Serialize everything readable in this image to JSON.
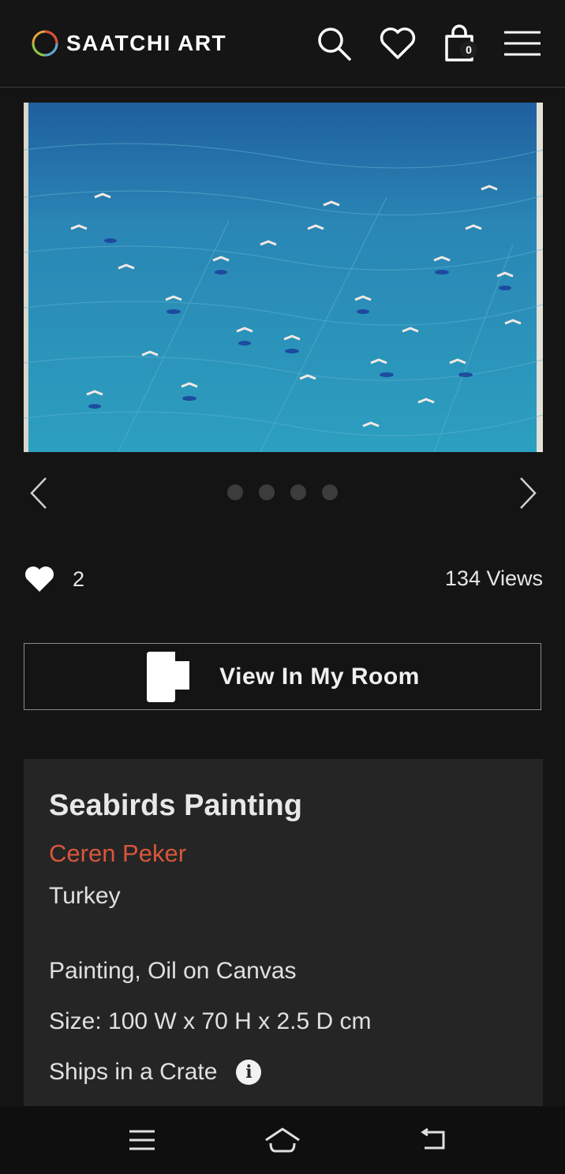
{
  "header": {
    "logo_text": "SAATCHI ART",
    "cart_count": "0",
    "icons": [
      "search-icon",
      "heart-icon",
      "shopping-bag-icon",
      "menu-icon"
    ]
  },
  "artwork": {
    "image_alt": "Seabirds Painting",
    "dots_count": 4,
    "active_dot": 0
  },
  "stats": {
    "likes": "2",
    "views": "134 Views"
  },
  "view_room": {
    "label": "View In My Room"
  },
  "details": {
    "title": "Seabirds Painting",
    "artist": "Ceren Peker",
    "country": "Turkey",
    "medium": "Painting, Oil on Canvas",
    "size": "Size: 100 W x 70 H x 2.5 D cm",
    "shipping": "Ships in a Crate",
    "info_glyph": "i"
  },
  "colors": {
    "background": "#141414",
    "card": "#252525",
    "artist_accent": "#d9563a",
    "sea": "#2e8fb3"
  },
  "system_nav": {
    "icons": [
      "recents-icon",
      "home-icon",
      "back-icon"
    ]
  }
}
